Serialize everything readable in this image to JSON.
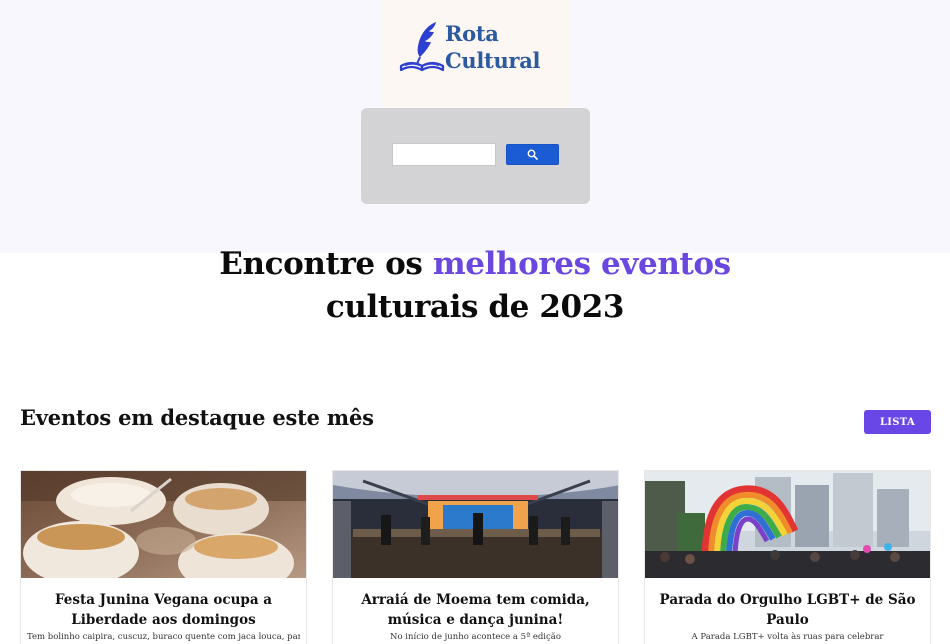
{
  "header": {
    "logo": {
      "line1": "Rota",
      "line2": "Cultural",
      "brand_color": "#2c5aa0"
    },
    "search": {
      "input_value": "",
      "button_icon": "search-icon",
      "button_color": "#1b5bd4"
    }
  },
  "hero": {
    "text_before": "Encontre os ",
    "accent": "melhores eventos",
    "text_after": "culturais de 2023",
    "accent_color": "#6a48e0"
  },
  "featured": {
    "title": "Eventos em destaque este mês",
    "list_button": "LISTA",
    "list_button_color": "#6847e6"
  },
  "cards": [
    {
      "title": "Festa Junina Vegana ocupa a Liberdade aos domingos",
      "description": "Tem bolinho caipira, cuscuz, buraco quente com jaca louca, pamonha,"
    },
    {
      "title": "Arraiá de Moema tem comida, música e dança junina!",
      "description": "No início de junho acontece a 5ª edição"
    },
    {
      "title": "Parada do Orgulho LGBT+ de São Paulo",
      "description": "A Parada LGBT+ volta às ruas para celebrar"
    }
  ]
}
